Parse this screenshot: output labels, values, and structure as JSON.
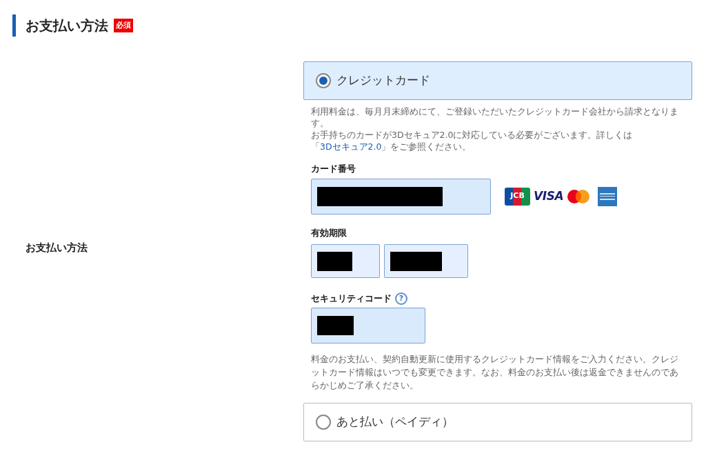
{
  "section": {
    "title": "お支払い方法",
    "required_badge": "必須"
  },
  "row_label": "お支払い方法",
  "payment_options": [
    {
      "label": "クレジットカード",
      "selected": true
    },
    {
      "label": "あと払い（ペイディ）",
      "selected": false
    }
  ],
  "credit_card": {
    "notes": [
      "利用料金は、毎月月末締めにて、ご登録いただいたクレジットカード会社から請求となります。",
      "お手持ちのカードが3Dセキュア2.0に対応している必要がございます。詳しくは"
    ],
    "link_before": "「",
    "link": "3Dセキュア2.0",
    "link_after": "」をご参照ください。",
    "card_number": {
      "label": "カード番号",
      "redacted": true
    },
    "brands": [
      {
        "kind": "jcb",
        "text": "JCB"
      },
      {
        "kind": "visa",
        "text": "VISA"
      },
      {
        "kind": "mastercard"
      },
      {
        "kind": "amex"
      }
    ],
    "expiry": {
      "label": "有効期限",
      "fields": [
        {
          "redacted": true
        },
        {
          "redacted": true
        }
      ]
    },
    "security_code": {
      "label": "セキュリティコード",
      "help": "?",
      "redacted": true
    },
    "footer_note": "料金のお支払い、契約自動更新に使用するクレジットカード情報をご入力ください。クレジットカード情報はいつでも変更できます。なお、料金のお支払い後は返金できませんのであらかじめご了承ください。"
  }
}
